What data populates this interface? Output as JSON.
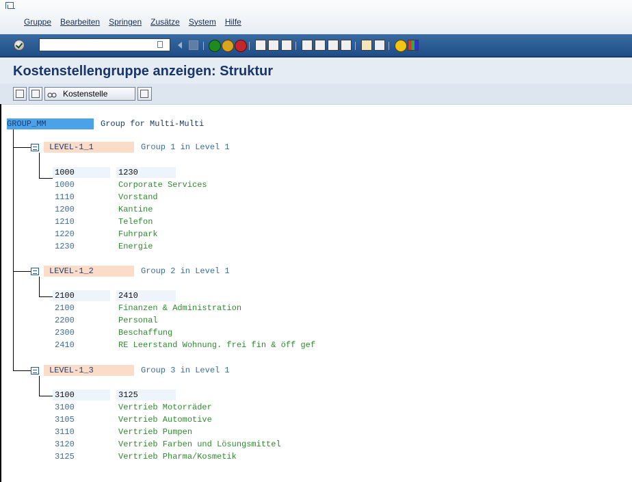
{
  "menu": {
    "items": [
      "Gruppe",
      "Bearbeiten",
      "Springen",
      "Zusätze",
      "System",
      "Hilfe"
    ]
  },
  "system_toolbar": {
    "command_value": "",
    "icons": [
      "enter-icon",
      "save-icon",
      "back-icon",
      "exit-icon",
      "cancel-icon",
      "print-icon",
      "find-icon",
      "find-next-icon",
      "first-page-icon",
      "previous-page-icon",
      "next-page-icon",
      "last-page-icon",
      "create-session-icon",
      "shortcut-icon",
      "help-icon",
      "layout-icon"
    ]
  },
  "title": "Kostenstellengruppe anzeigen: Struktur",
  "app_toolbar": {
    "kostenstelle_label": "Kostenstelle"
  },
  "tree": {
    "root": {
      "code": "GROUP_MM",
      "text": "Group for Multi-Multi"
    },
    "groups": [
      {
        "code": "LEVEL-1_1",
        "text": "Group 1 in Level 1",
        "range_from": "1000",
        "range_to": "1230",
        "items": [
          {
            "code": "1000",
            "text": "Corporate Services"
          },
          {
            "code": "1110",
            "text": "Vorstand"
          },
          {
            "code": "1200",
            "text": "Kantine"
          },
          {
            "code": "1210",
            "text": "Telefon"
          },
          {
            "code": "1220",
            "text": "Fuhrpark"
          },
          {
            "code": "1230",
            "text": "Energie"
          }
        ]
      },
      {
        "code": "LEVEL-1_2",
        "text": "Group 2 in Level 1",
        "range_from": "2100",
        "range_to": "2410",
        "items": [
          {
            "code": "2100",
            "text": "Finanzen & Administration"
          },
          {
            "code": "2200",
            "text": "Personal"
          },
          {
            "code": "2300",
            "text": "Beschaffung"
          },
          {
            "code": "2410",
            "text": "RE Leerstand Wohnung. frei fin & öff gef"
          }
        ]
      },
      {
        "code": "LEVEL-1_3",
        "text": "Group 3 in Level 1",
        "range_from": "3100",
        "range_to": "3125",
        "items": [
          {
            "code": "3100",
            "text": "Vertrieb Motorräder"
          },
          {
            "code": "3105",
            "text": "Vertrieb Automotive"
          },
          {
            "code": "3110",
            "text": "Vertrieb Pumpen"
          },
          {
            "code": "3120",
            "text": "Vertrieb Farben und Lösungsmittel"
          },
          {
            "code": "3125",
            "text": "Vertrieb Pharma/Kosmetik"
          }
        ]
      }
    ]
  }
}
